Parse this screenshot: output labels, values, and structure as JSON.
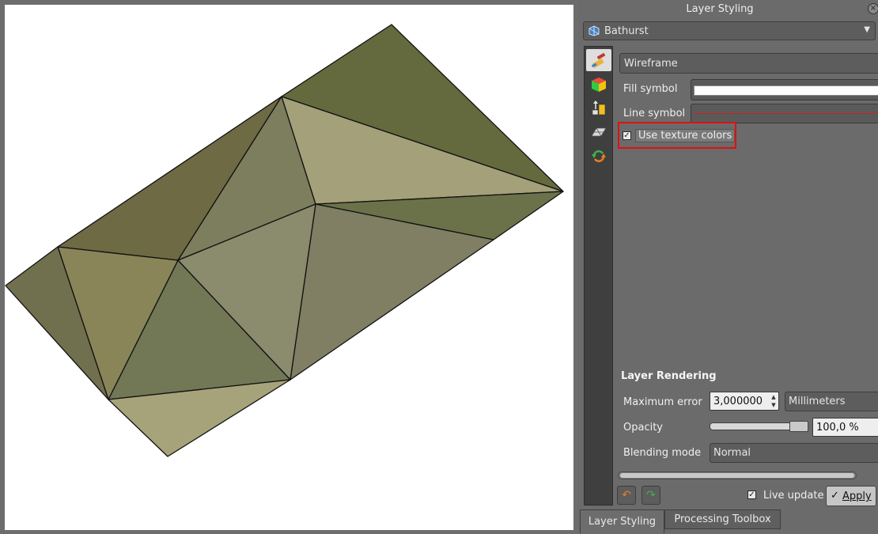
{
  "panel": {
    "title": "Layer Styling",
    "close_icon": "close-icon",
    "layer_name": "Bathurst",
    "layer_icon": "mesh-layer-icon"
  },
  "side_tabs": [
    {
      "name": "symbology-tab",
      "icon": "paintbrush-icon",
      "selected": true
    },
    {
      "name": "3d-view-tab",
      "icon": "cube-icon",
      "selected": false
    },
    {
      "name": "elevation-tab",
      "icon": "elevation-icon",
      "selected": false
    },
    {
      "name": "mesh-tab",
      "icon": "mesh-icon",
      "selected": false
    },
    {
      "name": "history-tab",
      "icon": "history-icon",
      "selected": false
    }
  ],
  "renderer": {
    "type": "Wireframe",
    "fill_symbol_label": "Fill symbol",
    "line_symbol_label": "Line symbol",
    "fill_color": "#ffffff",
    "line_color": "#d32020",
    "use_texture_label": "Use texture colors",
    "use_texture_checked": true
  },
  "layer_rendering": {
    "heading": "Layer Rendering",
    "max_error_label": "Maximum error",
    "max_error_value": "3,000000",
    "max_error_unit": "Millimeters",
    "opacity_label": "Opacity",
    "opacity_value": "100,0 %",
    "opacity_fraction": 1.0,
    "blending_label": "Blending mode",
    "blending_value": "Normal"
  },
  "footer": {
    "live_update_label": "Live update",
    "live_update_checked": true,
    "apply_label": "Apply",
    "undo_icon": "undo-icon",
    "redo_icon": "redo-icon"
  },
  "bottom_tabs": [
    {
      "label": "Layer Styling",
      "active": true
    },
    {
      "label": "Processing Toolbox",
      "active": false
    }
  ],
  "colors": {
    "highlight": "#e01010",
    "panel_bg": "#6b6b6b"
  }
}
